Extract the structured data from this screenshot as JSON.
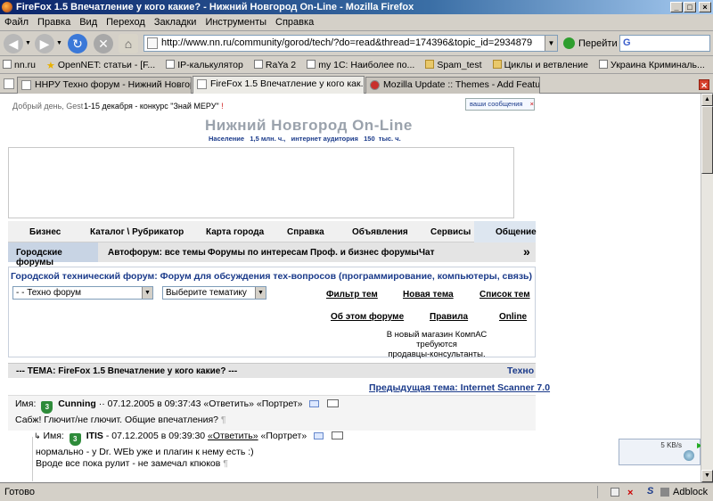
{
  "window": {
    "title": "FireFox 1.5 Впечатление у кого какие? - Нижний Новгород On-Line - Mozilla Firefox",
    "btn_min": "_",
    "btn_max": "□",
    "btn_close": "×"
  },
  "menu": [
    "Файл",
    "Правка",
    "Вид",
    "Переход",
    "Закладки",
    "Инструменты",
    "Справка"
  ],
  "nav": {
    "url": "http://www.nn.ru/community/gorod/tech/?do=read&thread=174396&topic_id=2934879",
    "go_label": "Перейти",
    "search_value": "G"
  },
  "bookmarks": [
    {
      "label": "nn.ru",
      "icon": "page"
    },
    {
      "label": "OpenNET: статьи - [F...",
      "icon": "star"
    },
    {
      "label": "IP-калькулятор",
      "icon": "page"
    },
    {
      "label": "RaYa 2",
      "icon": "page"
    },
    {
      "label": "my 1С: Наиболее по...",
      "icon": "page"
    },
    {
      "label": "Spam_test",
      "icon": "folder"
    },
    {
      "label": "Циклы и ветвление",
      "icon": "folder"
    },
    {
      "label": "Украина Криминаль...",
      "icon": "page"
    }
  ],
  "tabs": [
    {
      "label": "ННРУ Техно форум - Нижний Новгород ..."
    },
    {
      "label": "FireFox 1.5 Впечатление у кого как..."
    },
    {
      "label": "Mozilla Update :: Themes - Add Features to ..."
    }
  ],
  "page": {
    "greeting": "Добрый день, Gest",
    "contest": "1-15 декабря - конкурс \"Знай МЕРУ\"",
    "contest_mark": "!",
    "messages_btn": "ваши сообщения",
    "messages_close": "×",
    "logo": "Нижний Новгород On-Line",
    "stats_population_label": "Население",
    "stats_population_value": "1,5 млн. ч.,",
    "stats_audience_label": "интернет аудитория",
    "stats_audience_value": "150",
    "stats_audience_unit": "тыс. ч.",
    "categories": [
      "Бизнес",
      "Каталог \\ Рубрикатор",
      "Карта города",
      "Справка",
      "Объявления",
      "Сервисы",
      "Общение"
    ],
    "subnav": [
      "Городские форумы",
      "Автофорум: все темы",
      "Форумы по интересам",
      "Проф. и бизнес форумы",
      "Чат"
    ],
    "subnav_more": "»",
    "forum_title": "Городской технический форум: Форум для обсуждения тех-вопросов (программирование, компьютеры, связь)",
    "select_forum": "- - Техно форум",
    "select_theme": "Выберите тематику",
    "links_row1": [
      "Фильтр тем",
      "Новая тема",
      "Список тем"
    ],
    "links_row2": [
      "Об этом форуме",
      "Правила",
      "Online"
    ],
    "ad_line1": "В новый магазин КомпАС требуются",
    "ad_line2": "продавцы-консультанты.",
    "topic_header": "--- ТЕМА: FireFox 1.5 Впечатление у кого какие? ---",
    "topic_section": "Техно",
    "prev_topic": "Предыдущая тема: Internet Scanner 7.0",
    "posts": [
      {
        "name_label": "Имя:",
        "level": "3",
        "author": "Cunning",
        "date": "·· 07.12.2005 в 09:37:43",
        "reply": "«Ответить»",
        "portrait": "«Портрет»",
        "lines": [
          "Сабж! Глючит/не глючит. Общие впечатления?"
        ],
        "marker": "¶"
      },
      {
        "name_label": "Имя:",
        "level": "3",
        "author": "ITIS",
        "date": "- 07.12.2005 в 09:39:30",
        "reply": "«Ответить»",
        "portrait": "«Портрет»",
        "lines": [
          "нормально - у Dr. WEb уже и плагин к нему есть :)",
          "Вроде все пока рулит - не замечал кпюков"
        ],
        "marker": "¶"
      }
    ]
  },
  "widget": {
    "speed": "5 KB/s"
  },
  "status": {
    "text": "Готово",
    "addon": "Adblock"
  },
  "colors": {
    "titlebar": "#0a246a",
    "logo": "#9aa2ac",
    "forum_title": "#1a3a8a",
    "badge": "#2e8b3a"
  }
}
